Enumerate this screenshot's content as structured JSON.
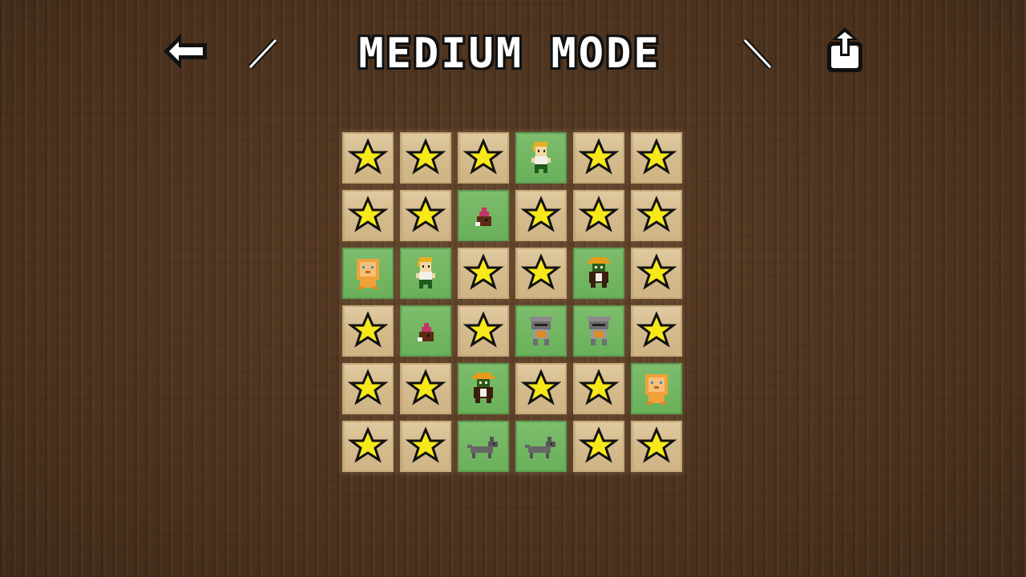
{
  "header": {
    "title": "MEDIUM MODE",
    "back_icon": "left-arrow-icon",
    "export_icon": "export-icon"
  },
  "colors": {
    "background": "#4f3520",
    "hidden_tile": "#d8c193",
    "revealed_tile": "#72b562",
    "star_fill": "#f7e81a",
    "title_text": "#ffffff"
  },
  "board": {
    "columns": 6,
    "rows": [
      [
        "star",
        "star",
        "star",
        "boy",
        "star",
        "star"
      ],
      [
        "star",
        "star",
        "mole",
        "star",
        "star",
        "star"
      ],
      [
        "lion",
        "boy",
        "star",
        "star",
        "goblin",
        "star"
      ],
      [
        "star",
        "mole",
        "star",
        "knight",
        "knight",
        "star"
      ],
      [
        "star",
        "star",
        "goblin",
        "star",
        "star",
        "lion"
      ],
      [
        "star",
        "star",
        "wolf",
        "wolf",
        "star",
        "star"
      ]
    ]
  }
}
